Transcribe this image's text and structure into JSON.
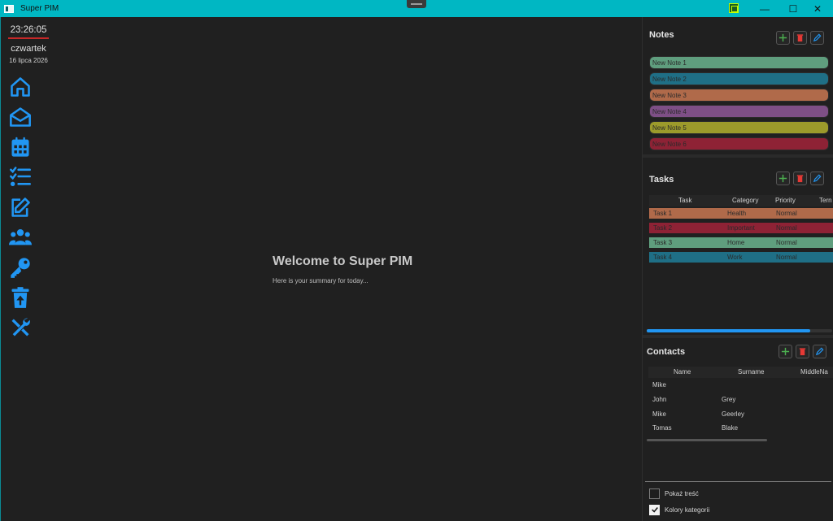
{
  "window": {
    "title": "Super PIM",
    "minimize": "—",
    "maximize": "☐",
    "close": "✕"
  },
  "sidebar": {
    "time": "23:26:05",
    "day": "czwartek",
    "date": "16 lipca 2026",
    "icons": [
      "home-icon",
      "mail-icon",
      "calendar-icon",
      "tasks-icon",
      "edit-note-icon",
      "contacts-icon",
      "key-icon",
      "trash-restore-icon",
      "tools-icon"
    ]
  },
  "main": {
    "title": "Welcome to Super PIM",
    "subtitle": "Here is your summary for today..."
  },
  "notes": {
    "title": "Notes",
    "items": [
      {
        "label": "New Note 1",
        "color": "#5f9e7e"
      },
      {
        "label": "New Note 2",
        "color": "#1f6f86"
      },
      {
        "label": "New Note 3",
        "color": "#b06a4a"
      },
      {
        "label": "New Note 4",
        "color": "#7e4f86"
      },
      {
        "label": "New Note 5",
        "color": "#9c9a2b"
      },
      {
        "label": "New Note 6",
        "color": "#8e2235"
      }
    ]
  },
  "tasks": {
    "title": "Tasks",
    "columns": [
      "Task",
      "Category",
      "Priority",
      "Tern"
    ],
    "rows": [
      {
        "task": "Task 1",
        "category": "Health",
        "priority": "Normal",
        "color": "#b06a4a"
      },
      {
        "task": "Task 2",
        "category": "Important",
        "priority": "Normal",
        "color": "#8e2235"
      },
      {
        "task": "Task 3",
        "category": "Home",
        "priority": "Normal",
        "color": "#5f9e7e"
      },
      {
        "task": "Task 4",
        "category": "Work",
        "priority": "Normal",
        "color": "#1f6f86"
      }
    ],
    "progress": 0.88
  },
  "contacts": {
    "title": "Contacts",
    "columns": [
      "Name",
      "Surname",
      "MiddleNa"
    ],
    "rows": [
      {
        "name": "Mike",
        "surname": ""
      },
      {
        "name": "John",
        "surname": "Grey"
      },
      {
        "name": "Mike",
        "surname": "Geerley"
      },
      {
        "name": "Tomas",
        "surname": "Blake"
      }
    ]
  },
  "options": {
    "show_content": {
      "label": "Pokaż treść",
      "checked": false
    },
    "category_colors": {
      "label": "Kolory kategorii",
      "checked": true
    }
  },
  "colors": {
    "accent": "#2196f3",
    "titlebar": "#00b7c3",
    "add": "#4caf50",
    "delete": "#e53935"
  }
}
